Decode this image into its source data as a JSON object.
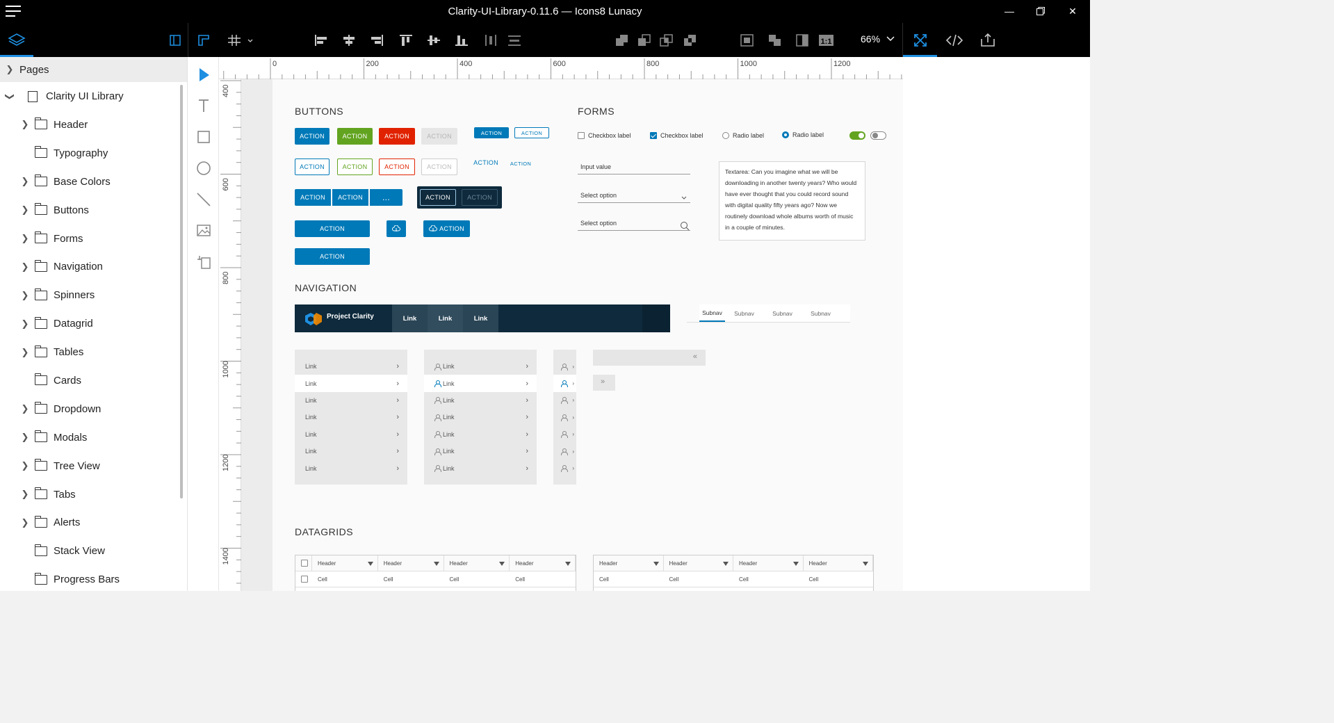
{
  "window": {
    "title": "Clarity-UI-Library-0.11.6 — Icons8 Lunacy"
  },
  "toolbar": {
    "zoom": "66%"
  },
  "sidebar": {
    "pages_label": "Pages",
    "root": "Clarity UI Library",
    "items": [
      {
        "label": "Header",
        "expandable": true
      },
      {
        "label": "Typography",
        "expandable": false
      },
      {
        "label": "Base Colors",
        "expandable": true
      },
      {
        "label": "Buttons",
        "expandable": true
      },
      {
        "label": "Forms",
        "expandable": true
      },
      {
        "label": "Navigation",
        "expandable": true
      },
      {
        "label": "Spinners",
        "expandable": true
      },
      {
        "label": "Datagrid",
        "expandable": true
      },
      {
        "label": "Tables",
        "expandable": true
      },
      {
        "label": "Cards",
        "expandable": false
      },
      {
        "label": "Dropdown",
        "expandable": true
      },
      {
        "label": "Modals",
        "expandable": true
      },
      {
        "label": "Tree View",
        "expandable": true
      },
      {
        "label": "Tabs",
        "expandable": true
      },
      {
        "label": "Alerts",
        "expandable": true
      },
      {
        "label": "Stack View",
        "expandable": false
      },
      {
        "label": "Progress Bars",
        "expandable": false
      }
    ]
  },
  "ruler": {
    "h": [
      "0",
      "200",
      "400",
      "600",
      "800",
      "1000",
      "1200"
    ],
    "v": [
      "400",
      "600",
      "800",
      "1000",
      "1200",
      "1400"
    ]
  },
  "artboard": {
    "buttons": {
      "title": "BUTTONS",
      "label": "ACTION",
      "ellipsis": "..."
    },
    "forms": {
      "title": "FORMS",
      "checkbox1": "Checkbox label",
      "checkbox2": "Checkbox label",
      "radio1": "Radio label",
      "radio2": "Radio label",
      "input_value": "Input value",
      "select1": "Select option",
      "select2": "Select option",
      "textarea": "Textarea: Can you imagine what we will be downloading in another twenty years? Who would have ever thought that you could record sound with digital quality fifty years ago? Now we routinely download whole albums worth of music in a couple of minutes."
    },
    "navigation": {
      "title": "NAVIGATION",
      "brand": "Project Clarity",
      "links": [
        "Link",
        "Link",
        "Link"
      ],
      "subnav": [
        "Subnav",
        "Subnav",
        "Subnav",
        "Subnav"
      ],
      "vnav_items": [
        "Link",
        "Link",
        "Link",
        "Link",
        "Link",
        "Link",
        "Link"
      ]
    },
    "datagrids": {
      "title": "DATAGRIDS",
      "header": "Header",
      "cell": "Cell"
    }
  },
  "colors": {
    "primary": "#0079b8",
    "success": "#62a420",
    "danger": "#e12200",
    "header_bg": "#0e2a3c",
    "accent": "#1e8fe1"
  }
}
